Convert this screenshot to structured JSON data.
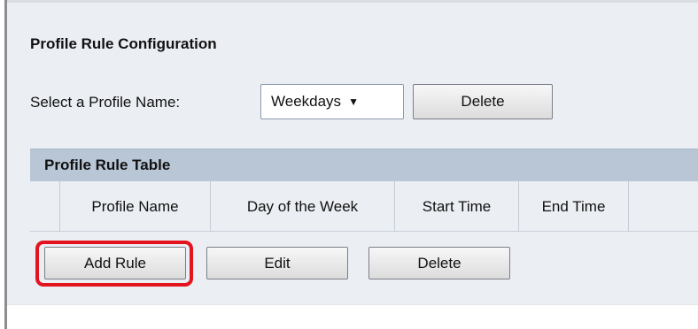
{
  "config": {
    "title": "Profile Rule Configuration",
    "select_label": "Select a Profile Name:",
    "selected_profile": "Weekdays",
    "delete_label": "Delete"
  },
  "table": {
    "title": "Profile Rule Table",
    "columns": [
      "Profile Name",
      "Day of the Week",
      "Start Time",
      "End Time"
    ]
  },
  "actions": {
    "add_rule": "Add Rule",
    "edit": "Edit",
    "delete": "Delete"
  },
  "colors": {
    "highlight": "#e4141f",
    "table_header_bg": "#b9c6d6",
    "panel_bg": "#ebeef3"
  },
  "icons": {
    "dropdown": "caret-down-icon"
  }
}
